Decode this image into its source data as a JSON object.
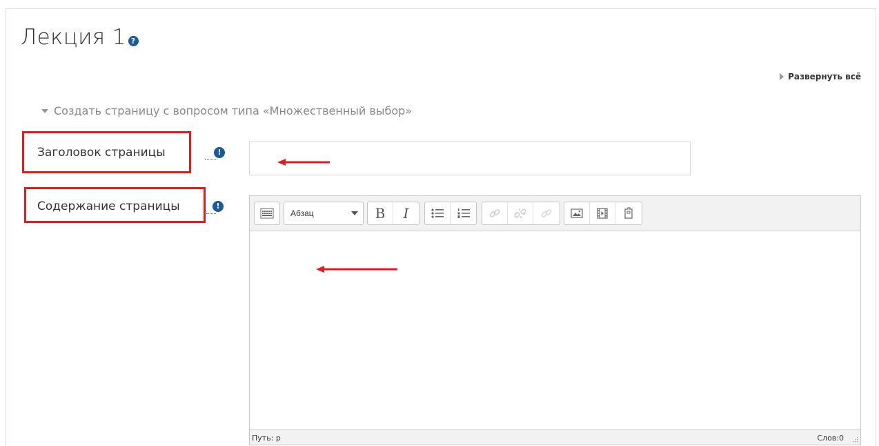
{
  "page": {
    "title": "Лекция 1",
    "title_help_glyph": "?"
  },
  "expand_all": {
    "label": "Развернуть всё"
  },
  "section": {
    "title": "Создать страницу с вопросом типа «Множественный выбор»"
  },
  "fields": {
    "page_title": {
      "label": "Заголовок страницы",
      "required_glyph": "!",
      "value": ""
    },
    "page_content": {
      "label": "Содержание страницы",
      "required_glyph": "!"
    }
  },
  "editor": {
    "format_select": "Абзац",
    "bold_label": "B",
    "italic_label": "I",
    "status_path": "Путь: p",
    "word_count": "Слов:0",
    "toolbar_icons": [
      "toolbar-toggle-icon",
      "unordered-list-icon",
      "ordered-list-icon",
      "link-icon",
      "unlink-icon",
      "anchor-icon",
      "image-icon",
      "media-icon",
      "manage-files-icon"
    ]
  },
  "colors": {
    "highlight": "#e41b1b",
    "icon_blue": "#1a5a9a",
    "section_gray": "#888888"
  }
}
